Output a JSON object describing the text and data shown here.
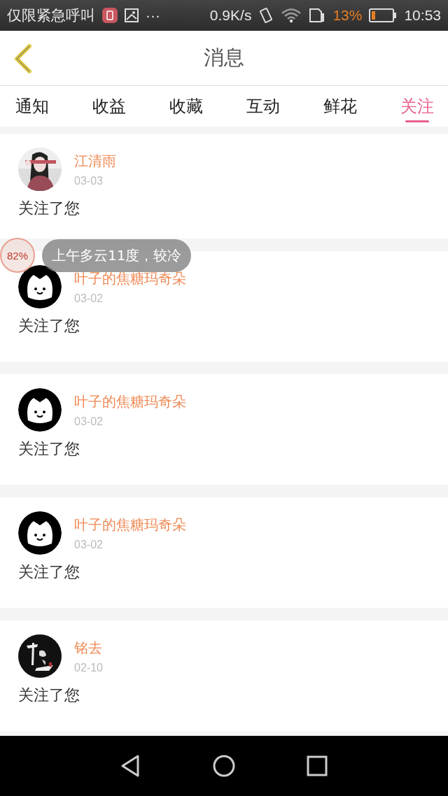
{
  "status_bar": {
    "carrier": "仅限紧急呼叫",
    "more": "···",
    "speed": "0.9K/s",
    "battery_percent": "13%",
    "time": "10:53"
  },
  "header": {
    "title": "消息"
  },
  "tabs": [
    {
      "label": "通知",
      "selected": false
    },
    {
      "label": "收益",
      "selected": false
    },
    {
      "label": "收藏",
      "selected": false
    },
    {
      "label": "互动",
      "selected": false
    },
    {
      "label": "鲜花",
      "selected": false
    },
    {
      "label": "关注",
      "selected": true
    }
  ],
  "messages": [
    {
      "name": "江清雨",
      "date": "03-03",
      "text": "关注了您"
    },
    {
      "avatar": {
        "kind": "icon"
      },
      "name": "叶子的焦糖玛奇朵",
      "date": "03-02",
      "text": "关注了您"
    },
    {
      "avatar": {
        "kind": "icon"
      },
      "name": "叶子的焦糖玛奇朵",
      "date": "03-02",
      "text": "关注了您"
    },
    {
      "avatar": {
        "kind": "icon"
      },
      "name": "叶子的焦糖玛奇朵",
      "date": "03-02",
      "text": "关注了您"
    },
    {
      "name": "铭去",
      "date": "02-10",
      "text": "关注了您"
    }
  ],
  "weather_bubble": {
    "percent": "82%",
    "text": "上午多云11度，较冷"
  }
}
